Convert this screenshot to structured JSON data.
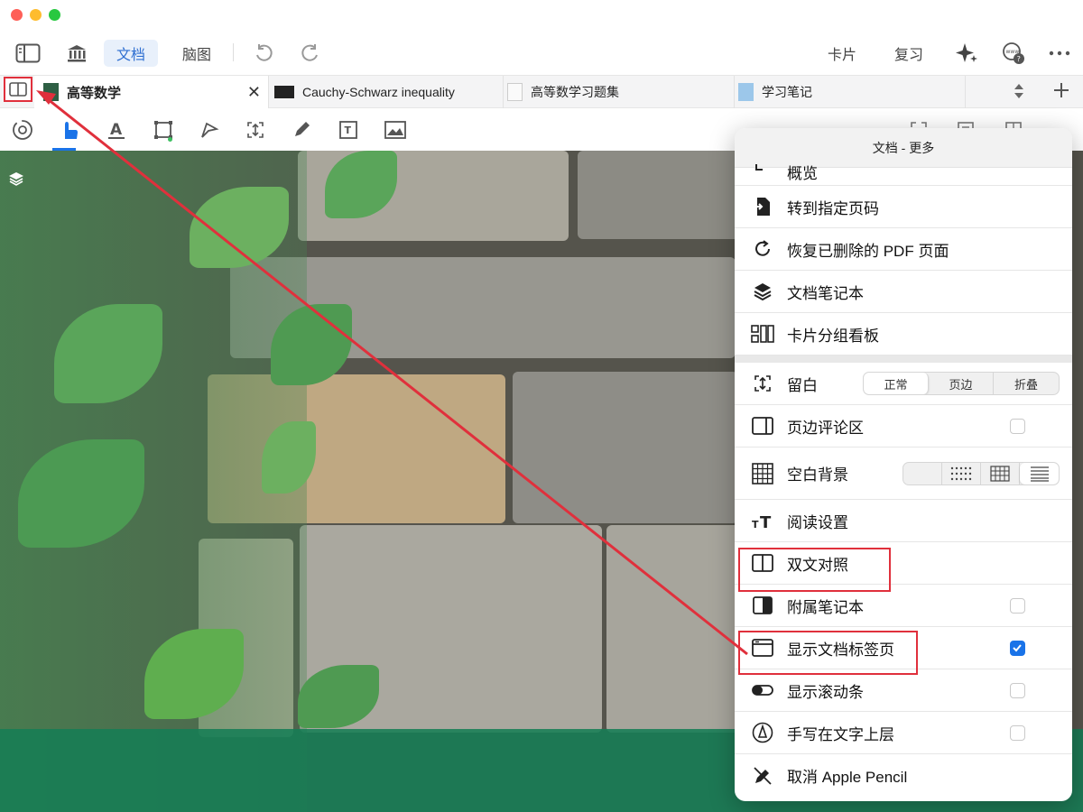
{
  "toolbar": {
    "doc_tab": "文档",
    "mindmap_tab": "脑图",
    "cards": "卡片",
    "review": "复习",
    "icons": [
      "sidebar-icon",
      "library-icon",
      "undo-icon",
      "redo-icon",
      "sparkle-icon",
      "web-search-icon",
      "more-icon"
    ]
  },
  "tabs": [
    {
      "label": "高等数学",
      "active": true
    },
    {
      "label": "Cauchy-Schwarz inequality",
      "active": false
    },
    {
      "label": "高等数学习题集",
      "active": false
    },
    {
      "label": "学习笔记",
      "active": false
    }
  ],
  "popover": {
    "title": "文档 - 更多",
    "items_top": [
      {
        "label": "概览",
        "icon": "outline-icon"
      },
      {
        "label": "转到指定页码",
        "icon": "goto-page-icon"
      },
      {
        "label": "恢复已删除的 PDF 页面",
        "icon": "restore-icon"
      },
      {
        "label": "文档笔记本",
        "icon": "layers-icon"
      },
      {
        "label": "卡片分组看板",
        "icon": "card-board-icon"
      }
    ],
    "margin": {
      "label": "留白",
      "options": [
        "正常",
        "页边",
        "折叠"
      ],
      "selected": "正常"
    },
    "margin_comment": {
      "label": "页边评论区",
      "checked": false
    },
    "blank_bg": {
      "label": "空白背景"
    },
    "reading": {
      "label": "阅读设置"
    },
    "dual": {
      "label": "双文对照"
    },
    "attached": {
      "label": "附属笔记本",
      "checked": false
    },
    "show_tabs": {
      "label": "显示文档标签页",
      "checked": true
    },
    "scrollbar": {
      "label": "显示滚动条",
      "checked": false
    },
    "handwrite": {
      "label": "手写在文字上层",
      "checked": false
    },
    "pencil": {
      "label": "取消 Apple Pencil"
    }
  },
  "colors": {
    "accent": "#2f6fd1",
    "highlight": "#e0303c",
    "checkbox_on": "#1a73e8"
  }
}
